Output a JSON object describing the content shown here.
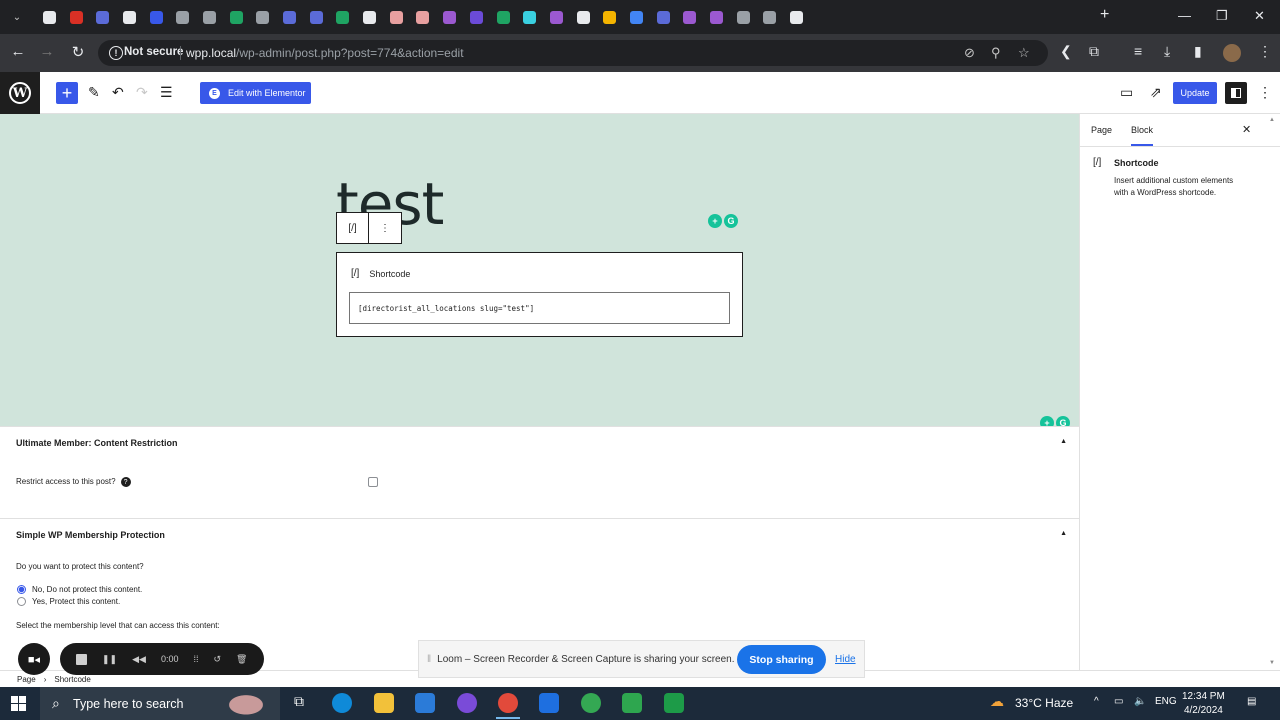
{
  "browser": {
    "active_tab_close": "✕",
    "new_tab": "+",
    "security_label": "Not secure",
    "url_host": "wpp.local",
    "url_path": "/wp-admin/post.php?post=774&action=edit",
    "tab_favicon_colors": [
      "#e8eaed",
      "#d93025",
      "#5b6bd8",
      "#e8eaed",
      "#3858e9",
      "#9aa0a6",
      "#9aa0a6",
      "#1fa463",
      "#9aa0a6",
      "#5b6bd8",
      "#5b6bd8",
      "#1fa463",
      "#e8eaed",
      "#e8a0a0",
      "#e8a0a0",
      "#9b59d0",
      "#6b4bd8",
      "#1fa463",
      "#3ad0e0",
      "#9b59d0",
      "#e8eaed",
      "#f4b400",
      "#4285f4",
      "#5b6bd8",
      "#9b59d0",
      "#9b59d0",
      "#9aa0a6",
      "#9aa0a6"
    ],
    "active_tab_index": 29
  },
  "editor": {
    "elementor_label": "Edit with Elementor",
    "update_label": "Update",
    "post_title": "test",
    "block_toolbar_icon": "[/]",
    "block_toolbar_more": "⋮",
    "shortcode_block": {
      "icon": "[/]",
      "title": "Shortcode",
      "value": "[directorist_all_locations slug=\"test\"]"
    }
  },
  "sidebar": {
    "tabs": [
      "Page",
      "Block"
    ],
    "active_tab": "Block",
    "close": "✕",
    "block_icon": "[/]",
    "block_title": "Shortcode",
    "block_description": "Insert additional custom elements with a WordPress shortcode."
  },
  "metaboxes": {
    "um": {
      "title": "Ultimate Member: Content Restriction",
      "restrict_label": "Restrict access to this post?",
      "help": "?"
    },
    "swpm": {
      "title": "Simple WP Membership Protection",
      "question": "Do you want to protect this content?",
      "option_no": "No, Do not protect this content.",
      "option_yes": "Yes, Protect this content.",
      "membership_label": "Select the membership level that can access this content:"
    }
  },
  "breadcrumb": {
    "root": "Page",
    "current": "Shortcode"
  },
  "loom": {
    "timer": "0:00",
    "share_message": "Loom – Screen Recorder & Screen Capture is sharing your screen.",
    "stop_label": "Stop sharing",
    "hide_label": "Hide"
  },
  "taskbar": {
    "search_placeholder": "Type here to search",
    "weather": "33°C  Haze",
    "language": "ENG",
    "time": "12:34 PM",
    "date": "4/2/2024",
    "notification_count": "2"
  }
}
